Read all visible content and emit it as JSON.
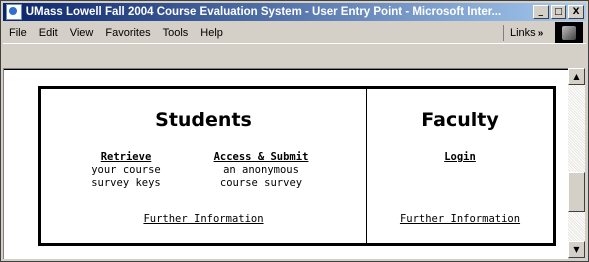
{
  "window": {
    "title": "UMass Lowell Fall 2004 Course Evaluation System - User Entry Point - Microsoft Inter...",
    "minimize_label": "_",
    "maximize_label": "□",
    "close_label": "X"
  },
  "menu": {
    "items": [
      "File",
      "Edit",
      "View",
      "Favorites",
      "Tools",
      "Help"
    ],
    "links_label": "Links",
    "links_chevron": "»"
  },
  "scrollbar": {
    "up": "▲",
    "down": "▼"
  },
  "students": {
    "heading": "Students",
    "retrieve": {
      "link": "Retrieve",
      "desc1": "your course",
      "desc2": "survey keys"
    },
    "access": {
      "link": "Access & Submit",
      "desc1": "an anonymous",
      "desc2": "course survey"
    },
    "further": "Further Information"
  },
  "faculty": {
    "heading": "Faculty",
    "login": "Login",
    "further": "Further Information"
  },
  "colors": {
    "titlebar_start": "#0a246a",
    "titlebar_end": "#a6caf0",
    "chrome": "#d4d0c8"
  }
}
